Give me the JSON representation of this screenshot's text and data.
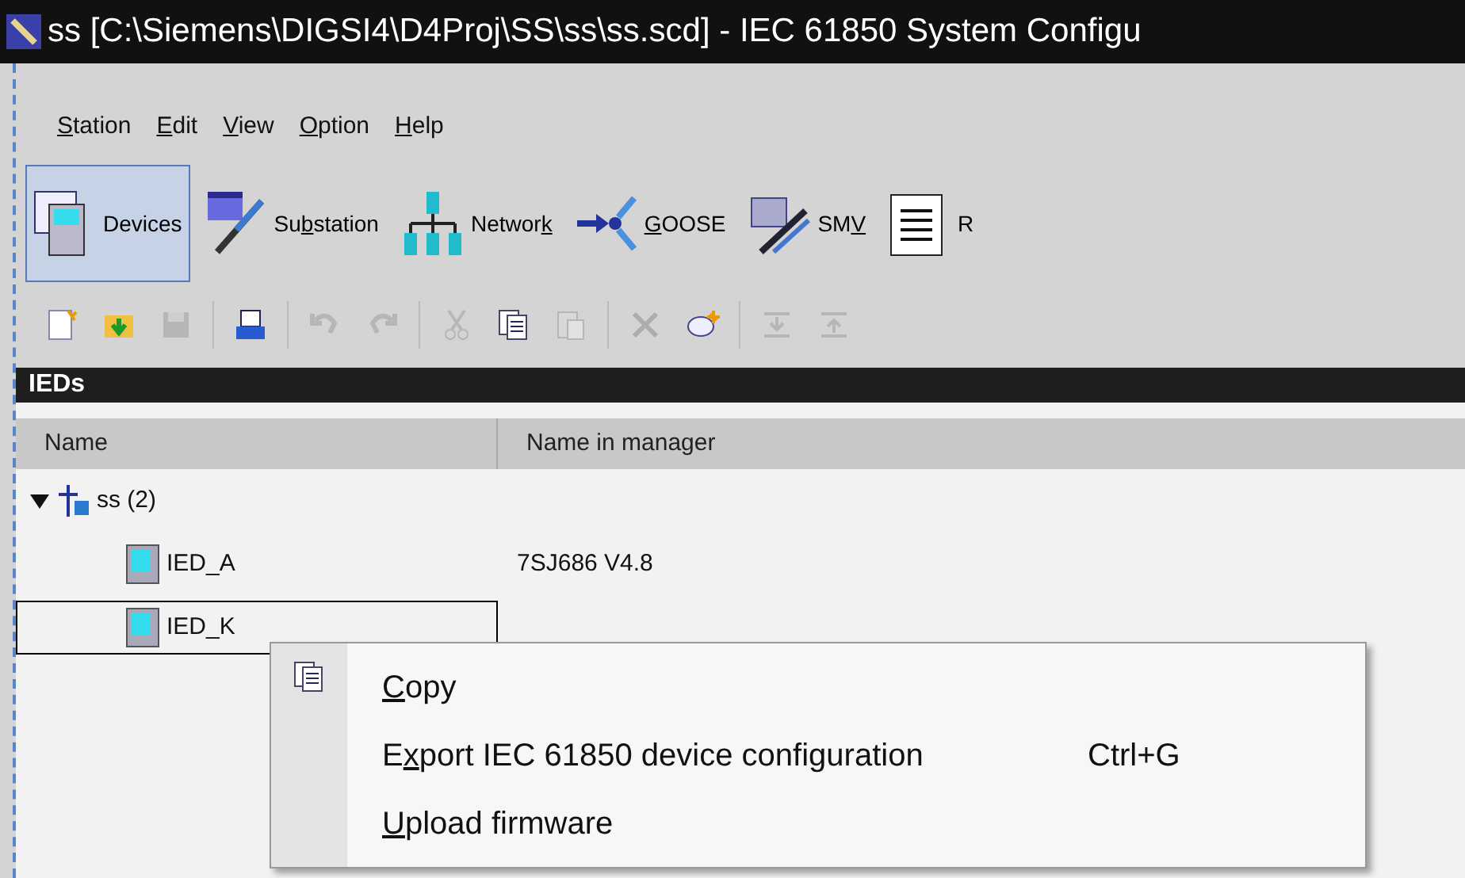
{
  "window": {
    "title": "ss [C:\\Siemens\\DIGSI4\\D4Proj\\SS\\ss\\ss.scd] - IEC 61850 System Configu"
  },
  "menu": [
    {
      "key": "S",
      "post": "tation"
    },
    {
      "key": "E",
      "post": "dit"
    },
    {
      "key": "V",
      "post": "iew"
    },
    {
      "key": "O",
      "post": "ption"
    },
    {
      "key": "H",
      "post": "elp"
    }
  ],
  "views": [
    {
      "pre": "Devices",
      "selected": true
    },
    {
      "pre": "Su",
      "key": "b",
      "post": "station",
      "selected": false
    },
    {
      "pre": "Networ",
      "key": "k",
      "selected": false
    },
    {
      "key": "G",
      "post": "OOSE",
      "selected": false
    },
    {
      "pre": "SM",
      "key": "V",
      "selected": false
    },
    {
      "pre": "R",
      "selected": false
    }
  ],
  "toolbar": [
    {
      "disabled": false
    },
    {
      "disabled": false
    },
    {
      "disabled": true
    },
    {
      "disabled": false
    },
    {
      "disabled": true
    },
    {
      "disabled": true
    },
    {
      "disabled": true
    },
    {
      "disabled": false
    },
    {
      "disabled": true
    },
    {
      "disabled": true
    },
    {
      "disabled": false
    },
    {
      "disabled": true
    },
    {
      "disabled": true
    }
  ],
  "panel": {
    "title": "IEDs",
    "columns": [
      "Name",
      "Name in manager"
    ],
    "tree": [
      {
        "name": "ss (2)",
        "expanded": true,
        "children": [
          {
            "name": "IED_A",
            "manager": "7SJ686 V4.8",
            "selected": false
          },
          {
            "name": "IED_K",
            "selected": true
          }
        ]
      }
    ]
  },
  "context_menu": [
    {
      "key": "C",
      "post": "opy",
      "has_icon": true
    },
    {
      "pre": "E",
      "key": "x",
      "post": "port IEC 61850 device configuration",
      "shortcut": "Ctrl+G",
      "has_icon": false
    },
    {
      "key": "U",
      "post": "pload firmware",
      "has_icon": false
    }
  ]
}
